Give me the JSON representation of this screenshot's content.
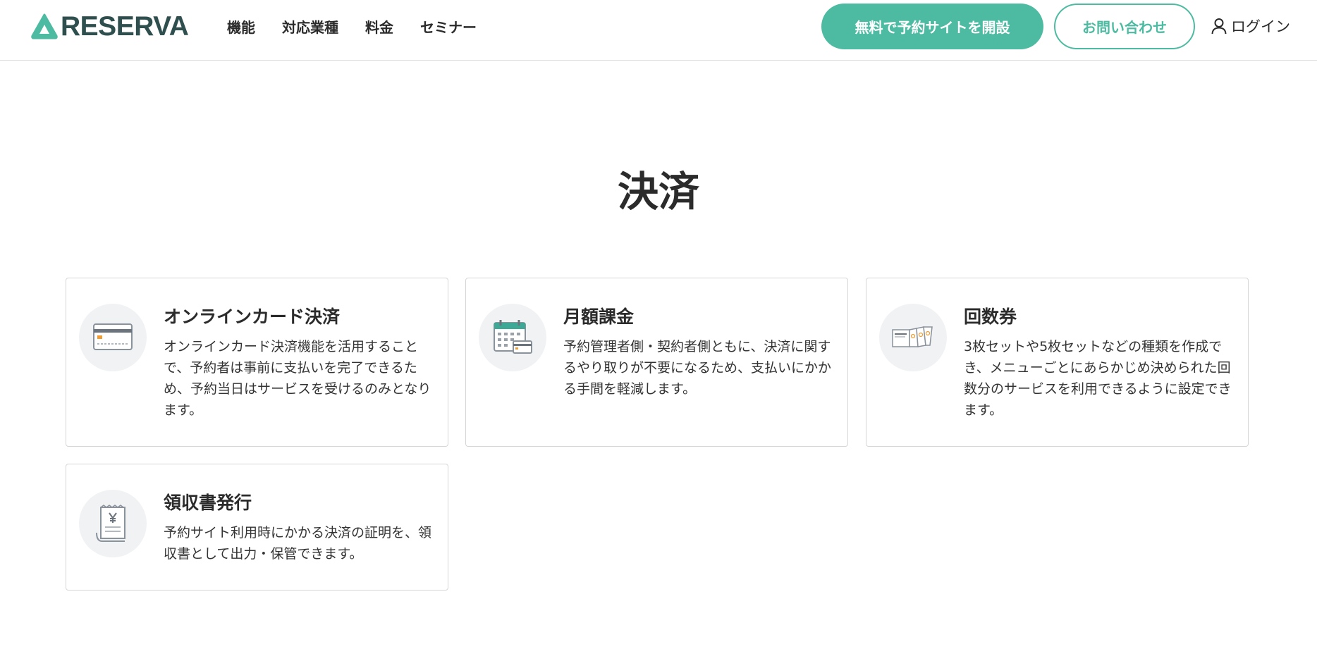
{
  "header": {
    "logo_text": "RESERVA",
    "nav": [
      "機能",
      "対応業種",
      "料金",
      "セミナー"
    ],
    "cta_primary": "無料で予約サイトを開設",
    "cta_secondary": "お問い合わせ",
    "login": "ログイン"
  },
  "colors": {
    "brand": "#4cbba1",
    "text": "#2b2b2b",
    "icon_bg": "#f1f2f4"
  },
  "page": {
    "title": "決済"
  },
  "cards": [
    {
      "icon": "credit-card-icon",
      "title": "オンラインカード決済",
      "description": "オンラインカード決済機能を活用することで、予約者は事前に支払いを完了できるため、予約当日はサービスを受けるのみとなります。"
    },
    {
      "icon": "calendar-card-icon",
      "title": "月額課金",
      "description": "予約管理者側・契約者側ともに、決済に関するやり取りが不要になるため、支払いにかかる手間を軽減します。"
    },
    {
      "icon": "ticket-icon",
      "title": "回数券",
      "description": "3枚セットや5枚セットなどの種類を作成でき、メニューごとにあらかじめ決められた回数分のサービスを利用できるように設定できます。"
    },
    {
      "icon": "receipt-icon",
      "title": "領収書発行",
      "description": "予約サイト利用時にかかる決済の証明を、領収書として出力・保管できます。"
    }
  ]
}
